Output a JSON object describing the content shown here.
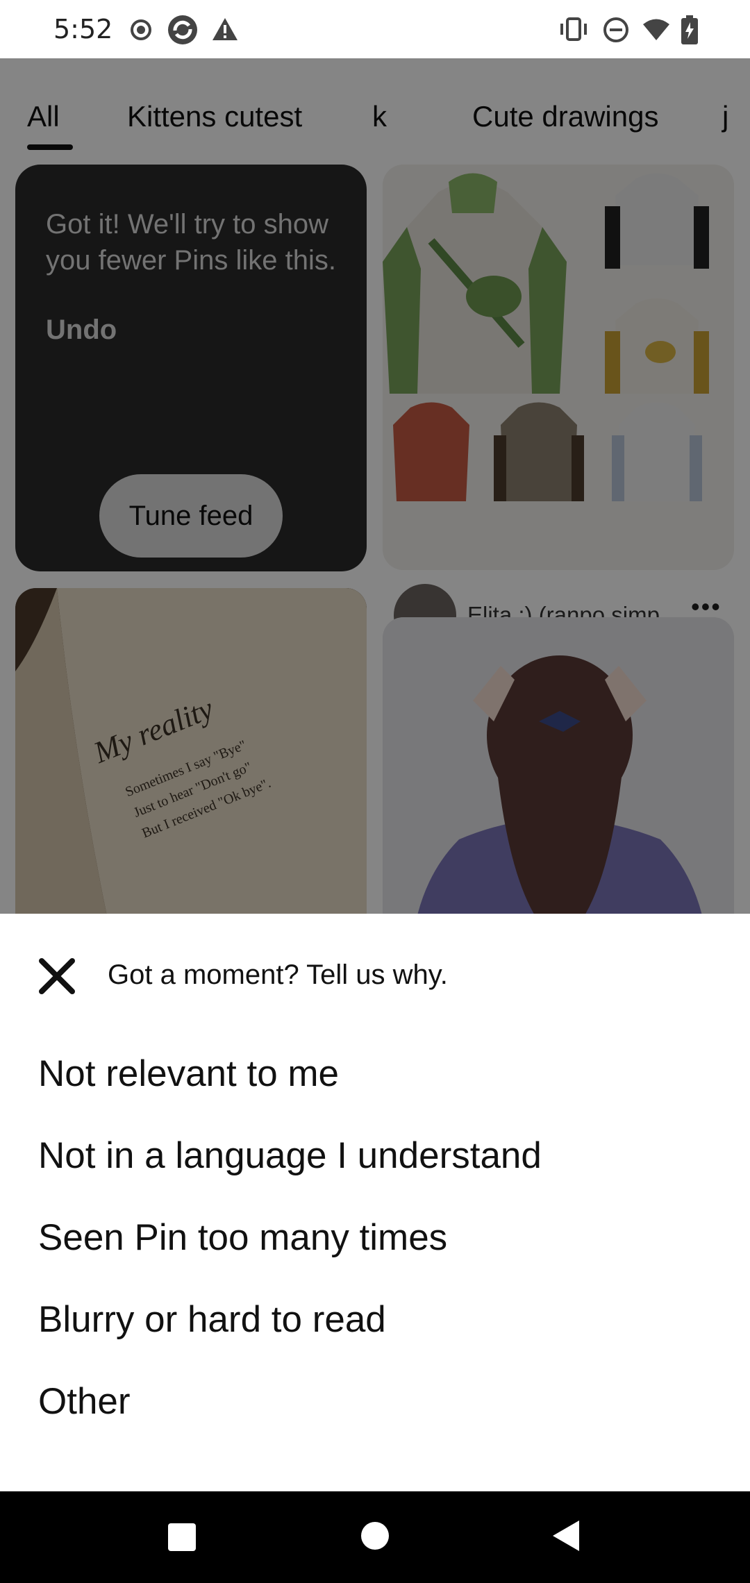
{
  "status_bar": {
    "time": "5:52",
    "left_icons": [
      "record-icon",
      "sync-app-icon",
      "warning-icon"
    ],
    "right_icons": [
      "vibrate-icon",
      "do-not-disturb-icon",
      "wifi-icon",
      "battery-charging-icon"
    ]
  },
  "feed": {
    "tabs": [
      {
        "label": "All",
        "selected": true
      },
      {
        "label": "Kittens cutest",
        "selected": false
      },
      {
        "label": "k",
        "selected": false
      },
      {
        "label": "Cute drawings",
        "selected": false
      },
      {
        "label": "j",
        "selected": false
      }
    ],
    "hidden_pin_card": {
      "message": "Got it! We'll try to show you fewer Pins like this.",
      "undo_label": "Undo",
      "tune_feed_label": "Tune feed"
    },
    "pin_author": {
      "name": "Elita :) (ranpo simp...",
      "more_label": "•••"
    },
    "book_pin": {
      "title": "My reality",
      "lines": [
        "Sometimes I say \"Bye\"",
        "Just to hear \"Don't go\"",
        "But I received \"Ok bye\"."
      ]
    }
  },
  "sheet": {
    "title": "Got a moment? Tell us why.",
    "close_icon": "close-icon",
    "options": [
      "Not relevant to me",
      "Not in a language I understand",
      "Seen Pin too many times",
      "Blurry or hard to read",
      "Other"
    ]
  },
  "nav_bar": {
    "icons": [
      "recents-square-icon",
      "home-circle-icon",
      "back-triangle-icon"
    ]
  }
}
